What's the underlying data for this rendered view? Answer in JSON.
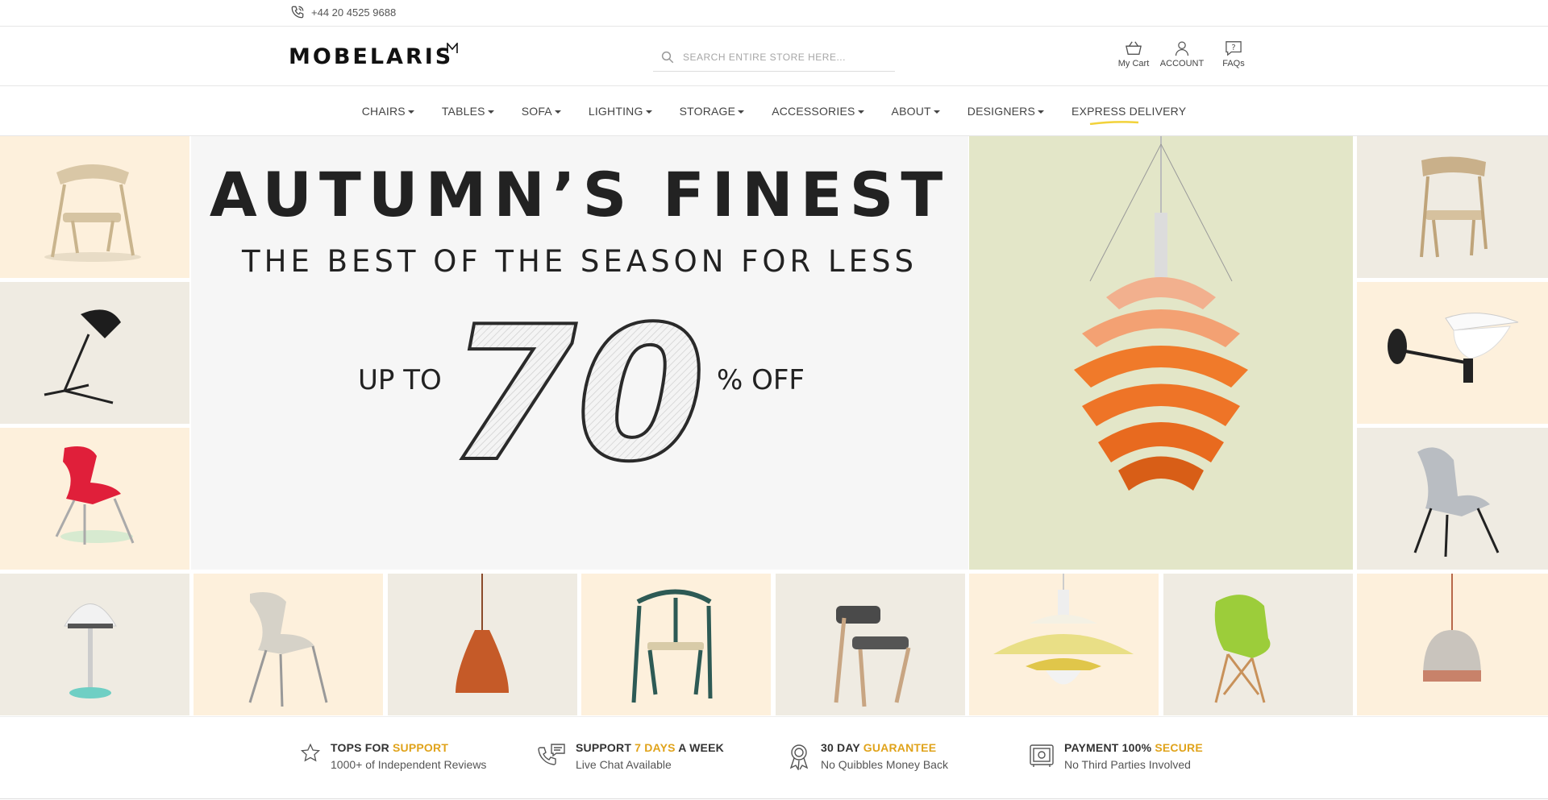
{
  "topbar": {
    "phone": "+44 20 4525 9688"
  },
  "header": {
    "logo": "MOBELARIS",
    "search_placeholder": "SEARCH ENTIRE STORE HERE...",
    "cart_label": "My Cart",
    "account_label": "ACCOUNT",
    "faqs_label": "FAQs"
  },
  "nav": {
    "items": [
      {
        "label": "CHAIRS"
      },
      {
        "label": "TABLES"
      },
      {
        "label": "SOFA"
      },
      {
        "label": "LIGHTING"
      },
      {
        "label": "STORAGE"
      },
      {
        "label": "ACCESSORIES"
      },
      {
        "label": "ABOUT"
      },
      {
        "label": "DESIGNERS"
      }
    ],
    "express": "EXPRESS DELIVERY"
  },
  "hero": {
    "title": "AUTUMN’S FINEST",
    "subtitle": "THE BEST OF THE SEASON FOR LESS",
    "up_to": "UP TO",
    "discount": "70",
    "off": "% OFF"
  },
  "features": [
    {
      "pre": "TOPS FOR ",
      "hl": "SUPPORT",
      "post": "",
      "sub": "1000+ of Independent Reviews",
      "icon": "star-icon"
    },
    {
      "pre": "SUPPORT ",
      "hl": "7 DAYS",
      "post": " A WEEK",
      "sub": "Live Chat Available",
      "icon": "phone-chat-icon"
    },
    {
      "pre": "30 DAY ",
      "hl": "GUARANTEE",
      "post": "",
      "sub": "No Quibbles Money Back",
      "icon": "award-ribbon-icon"
    },
    {
      "pre": "PAYMENT 100% ",
      "hl": "SECURE",
      "post": "",
      "sub": "No Third Parties Involved",
      "icon": "safe-icon"
    }
  ],
  "colors": {
    "accent": "#e0a31b",
    "cream": "#fdf0dc",
    "grey_tile": "#efebe2",
    "lamp_bg": "#e3e6c8",
    "lamp_orange": "#f07a2a"
  }
}
